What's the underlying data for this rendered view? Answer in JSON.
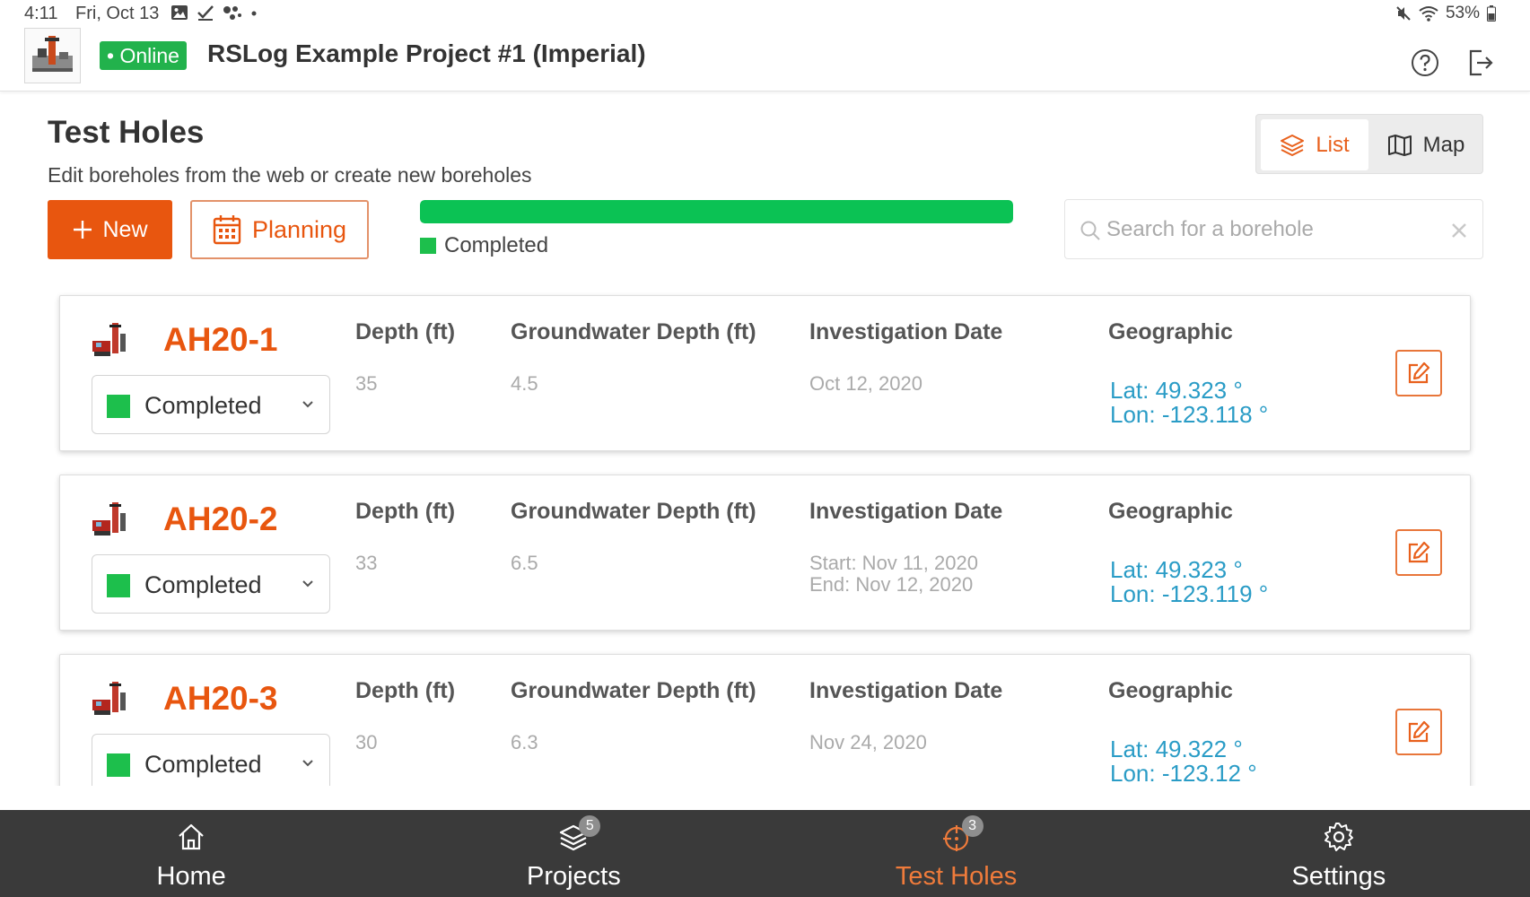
{
  "status_bar": {
    "time": "4:11",
    "date": "Fri, Oct 13",
    "battery": "53%"
  },
  "header": {
    "connection_status": "Online",
    "project_title": "RSLog Example Project #1 (Imperial)"
  },
  "page": {
    "title": "Test Holes",
    "subtitle": "Edit boreholes from the web or create new boreholes"
  },
  "view_toggle": {
    "list_label": "List",
    "map_label": "Map",
    "selected": "List"
  },
  "actions": {
    "new_label": "New",
    "planning_label": "Planning"
  },
  "progress": {
    "completed_fraction": 1.0,
    "legend_label": "Completed",
    "color": "#0bc254"
  },
  "search": {
    "placeholder": "Search for a borehole",
    "value": ""
  },
  "columns": {
    "depth": "Depth (ft)",
    "groundwater": "Groundwater Depth (ft)",
    "date": "Investigation Date",
    "geo": "Geographic"
  },
  "boreholes": [
    {
      "name": "AH20-1",
      "status": "Completed",
      "depth": "35",
      "groundwater": "4.5",
      "date_line1": "Oct 12, 2020",
      "date_line2": "",
      "lat": "Lat: 49.323 °",
      "lon": "Lon: -123.118 °"
    },
    {
      "name": "AH20-2",
      "status": "Completed",
      "depth": "33",
      "groundwater": "6.5",
      "date_line1": "Start: Nov 11, 2020",
      "date_line2": "End: Nov 12, 2020",
      "lat": "Lat: 49.323 °",
      "lon": "Lon: -123.119 °"
    },
    {
      "name": "AH20-3",
      "status": "Completed",
      "depth": "30",
      "groundwater": "6.3",
      "date_line1": "Nov 24, 2020",
      "date_line2": "",
      "lat": "Lat: 49.322 °",
      "lon": "Lon: -123.12 °"
    }
  ],
  "bottom_nav": {
    "home": "Home",
    "projects": "Projects",
    "projects_badge": "5",
    "test_holes": "Test Holes",
    "test_holes_badge": "3",
    "settings": "Settings",
    "active": "Test Holes"
  },
  "colors": {
    "accent": "#e8560f",
    "success": "#1dbf4c",
    "geo_text": "#2a9cc6",
    "nav_bg": "#3a3a3a"
  }
}
